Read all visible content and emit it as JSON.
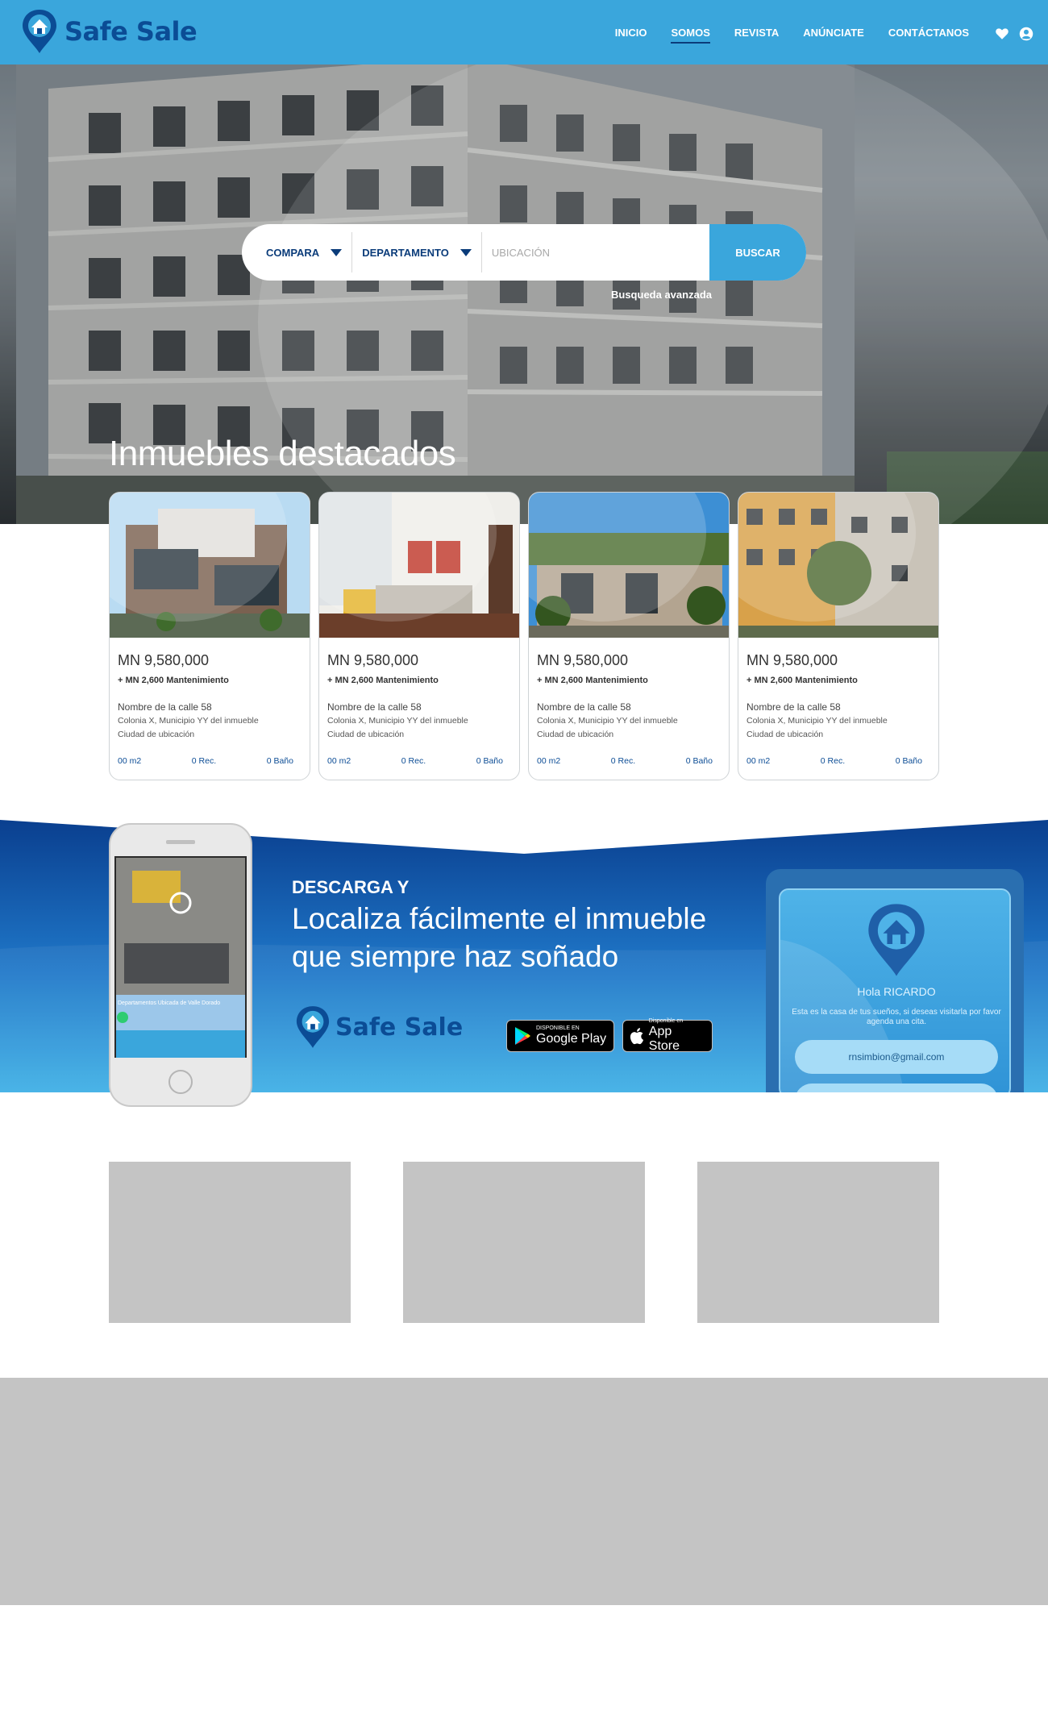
{
  "brand": {
    "name": "Safe Sale",
    "primary_color": "#3aa6dc",
    "dark_color": "#0b4c95"
  },
  "nav": {
    "items": [
      {
        "label": "INICIO",
        "active": false
      },
      {
        "label": "SOMOS",
        "active": true
      },
      {
        "label": "REVISTA",
        "active": false
      },
      {
        "label": "ANÚNCIATE",
        "active": false
      },
      {
        "label": "CONTÁCTANOS",
        "active": false
      }
    ],
    "icons": [
      "heart-icon",
      "user-icon"
    ]
  },
  "search": {
    "operation": "COMPARA",
    "type": "DEPARTAMENTO",
    "location_placeholder": "UBICACIÓN",
    "button": "BUSCAR",
    "advanced": "Busqueda avanzada"
  },
  "featured": {
    "title": "Inmuebles destacados",
    "cards": [
      {
        "price": "MN 9,580,000",
        "maintenance": "+ MN 2,600 Mantenimiento",
        "street": "Nombre de la calle 58",
        "colonia": "Colonia X, Municipio YY del inmueble",
        "city": "Ciudad de ubicación",
        "area": "00 m2",
        "rooms": "0 Rec.",
        "baths": "0 Baño"
      },
      {
        "price": "MN 9,580,000",
        "maintenance": "+ MN 2,600 Mantenimiento",
        "street": "Nombre de la calle 58",
        "colonia": "Colonia X, Municipio YY del inmueble",
        "city": "Ciudad de ubicación",
        "area": "00 m2",
        "rooms": "0 Rec.",
        "baths": "0 Baño"
      },
      {
        "price": "MN 9,580,000",
        "maintenance": "+ MN 2,600 Mantenimiento",
        "street": "Nombre de la calle 58",
        "colonia": "Colonia X, Municipio YY del inmueble",
        "city": "Ciudad de ubicación",
        "area": "00 m2",
        "rooms": "0 Rec.",
        "baths": "0 Baño"
      },
      {
        "price": "MN 9,580,000",
        "maintenance": "+ MN 2,600 Mantenimiento",
        "street": "Nombre de la calle 58",
        "colonia": "Colonia X, Municipio YY del inmueble",
        "city": "Ciudad de ubicación",
        "area": "00 m2",
        "rooms": "0 Rec.",
        "baths": "0 Baño"
      }
    ]
  },
  "app": {
    "kicker": "DESCARGA Y",
    "headline": "Localiza fácilmente el inmueble que siempre haz soñado",
    "logo_text": "Safe Sale",
    "google_small": "DISPONIBLE EN",
    "google_big": "Google Play",
    "apple_small": "Disponible en",
    "apple_big": "App Store",
    "phone_caption": "Departamentos Ubicada de Valle Dorado",
    "tablet_hello": "Hola RICARDO",
    "tablet_message": "Esta es la casa de tus sueños, si deseas visitarla por favor agenda una cita.",
    "tablet_email": "rnsimbion@gmail.com"
  }
}
